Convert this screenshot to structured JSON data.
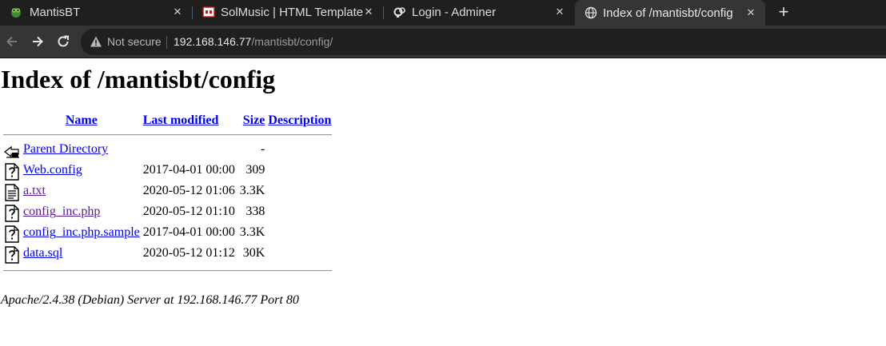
{
  "browser": {
    "tabs": [
      {
        "title": "MantisBT",
        "favicon": "mantis-icon"
      },
      {
        "title": "SolMusic | HTML Template",
        "favicon": "flag-icon"
      },
      {
        "title": "Login - Adminer",
        "favicon": "adminer-icon"
      },
      {
        "title": "Index of /mantisbt/config",
        "favicon": "globe-icon"
      }
    ],
    "security_label": "Not secure",
    "url_host": "192.168.146.77",
    "url_path": "/mantisbt/config/"
  },
  "page": {
    "title": "Index of /mantisbt/config",
    "columns": {
      "name": "Name",
      "last_modified": "Last modified",
      "size": "Size",
      "description": "Description"
    },
    "parent": {
      "name": "Parent Directory",
      "size": "-",
      "icon": "back-folder-icon"
    },
    "rows": [
      {
        "name": "Web.config",
        "modified": "2017-04-01 00:00",
        "size": "309",
        "icon": "unknown-file-icon",
        "visited": false
      },
      {
        "name": "a.txt",
        "modified": "2020-05-12 01:06",
        "size": "3.3K",
        "icon": "text-file-icon",
        "visited": true
      },
      {
        "name": "config_inc.php",
        "modified": "2020-05-12 01:10",
        "size": "338",
        "icon": "unknown-file-icon",
        "visited": true
      },
      {
        "name": "config_inc.php.sample",
        "modified": "2017-04-01 00:00",
        "size": "3.3K",
        "icon": "unknown-file-icon",
        "visited": false
      },
      {
        "name": "data.sql",
        "modified": "2020-05-12 01:12",
        "size": "30K",
        "icon": "unknown-file-icon",
        "visited": false
      }
    ],
    "footer": "Apache/2.4.38 (Debian) Server at 192.168.146.77 Port 80"
  }
}
